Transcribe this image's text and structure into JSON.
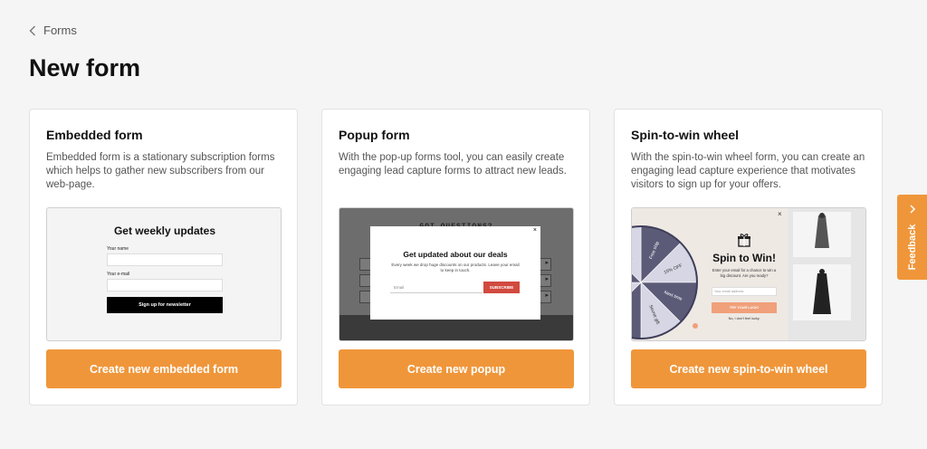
{
  "breadcrumb": {
    "label": "Forms"
  },
  "page": {
    "title": "New form"
  },
  "cards": [
    {
      "title": "Embedded form",
      "description": "Embedded form is a stationary subscription forms which helps to gather new subscribers from our web-page.",
      "cta": "Create new embedded form",
      "preview": {
        "title": "Get weekly updates",
        "name_label": "Your name",
        "email_label": "Your e-mail",
        "button": "Sign up for newsletter"
      }
    },
    {
      "title": "Popup form",
      "description": "With the pop-up forms tool, you can easily create engaging lead capture forms to attract new leads.",
      "cta": "Create new popup",
      "preview": {
        "background_title": "GOT QUESTIONS?",
        "title": "Get updated about our deals",
        "description": "Every week we drop huge discounts on our products. Leave your email to keep in touch.",
        "email_placeholder": "Email",
        "button": "SUBSCRIBE",
        "close": "×"
      }
    },
    {
      "title": "Spin-to-win wheel",
      "description": "With the spin-to-win wheel form, you can create an engaging lead capture experience that motivates visitors to sign up for your offers.",
      "cta": "Create new spin-to-win wheel",
      "preview": {
        "title": "Spin to Win!",
        "description": "Enter your email for a chance to win a big discount. Are you ready?",
        "email_placeholder": "Your email address",
        "button": "TRY YOUR LUCK!",
        "decline": "No, I don't feel lucky.",
        "close": "×",
        "wheel_segments": [
          "Free ship",
          "15% OFF",
          "Next time",
          "Secret gift",
          "Almost",
          "Free ship",
          "10% OFF",
          "Next time"
        ]
      }
    }
  ],
  "feedback": {
    "label": "Feedback"
  },
  "colors": {
    "accent": "#f0963a",
    "background": "#f5f5f5",
    "card": "#ffffff",
    "subscribe": "#d24a3f",
    "wheel_dark": "#5b5b78",
    "wheel_light": "#d6d6e4"
  }
}
